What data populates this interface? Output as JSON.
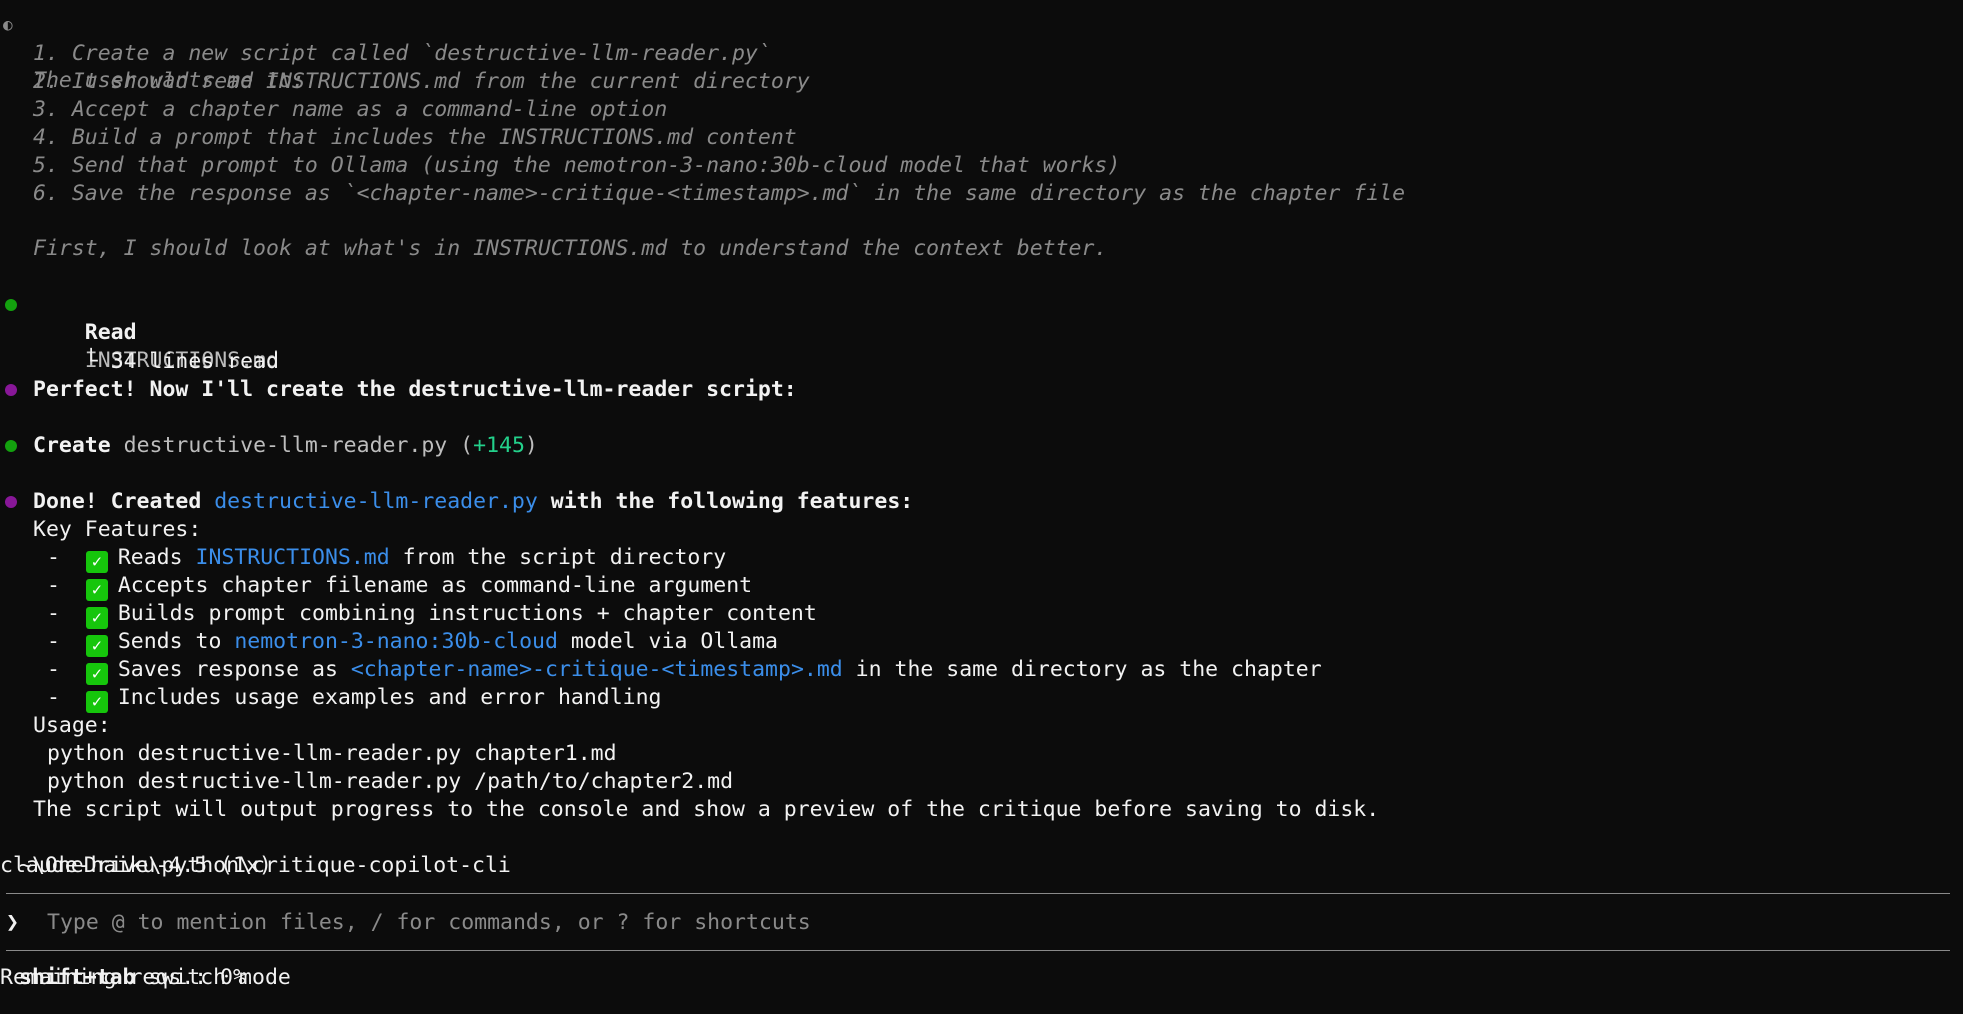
{
  "thinking": {
    "icon": "half-circle-icon",
    "lines": [
      "The user wants me to:",
      "1. Create a new script called `destructive-llm-reader.py`",
      "2. It should read INSTRUCTIONS.md from the current directory",
      "3. Accept a chapter name as a command-line option",
      "4. Build a prompt that includes the INSTRUCTIONS.md content",
      "5. Send that prompt to Ollama (using the nemotron-3-nano:30b-cloud model that works)",
      "6. Save the response as `<chapter-name>-critique-<timestamp>.md` in the same directory as the chapter file",
      "First, I should look at what's in INSTRUCTIONS.md to understand the context better."
    ]
  },
  "read_step": {
    "action": "Read",
    "target": "INSTRUCTIONS.md",
    "result_prefix": "└ ",
    "result": "34 lines read"
  },
  "message1": "Perfect! Now I'll create the destructive-llm-reader script:",
  "create_step": {
    "action": "Create",
    "target": "destructive-llm-reader.py",
    "open_paren": " (",
    "added": "+145",
    "close_paren": ")"
  },
  "done": {
    "prefix": "Done! Created ",
    "link": "destructive-llm-reader.py",
    "suffix": " with the following features:",
    "key_features_label": "Key Features:",
    "bullet": "-",
    "features": [
      {
        "before": "Reads ",
        "highlight": "INSTRUCTIONS.md",
        "after": " from the script directory"
      },
      {
        "before": "Accepts chapter filename as command-line argument",
        "highlight": "",
        "after": ""
      },
      {
        "before": "Builds prompt combining instructions + chapter content",
        "highlight": "",
        "after": ""
      },
      {
        "before": "Sends to ",
        "highlight": "nemotron-3-nano:30b-cloud",
        "after": " model via Ollama"
      },
      {
        "before": "Saves response as ",
        "highlight": "<chapter-name>-critique-<timestamp>.md",
        "after": " in the same directory as the chapter"
      },
      {
        "before": "Includes usage examples and error handling",
        "highlight": "",
        "after": ""
      }
    ],
    "usage_label": "Usage:",
    "usage_lines": [
      "python destructive-llm-reader.py chapter1.md",
      "python destructive-llm-reader.py /path/to/chapter2.md"
    ],
    "closing": "The script will output progress to the console and show a preview of the critique before saving to disk."
  },
  "status": {
    "path": "~\\OneDrive\\python\\critique-copilot-cli",
    "model": "claude-haiku-4.5 (1x)"
  },
  "input": {
    "prompt_glyph": "❯",
    "placeholder": "Type @ to mention files, / for commands, or ? for shortcuts"
  },
  "footer": {
    "key": "shift+tab",
    "key_desc": " switch mode",
    "remaining": "Remaining reqs.: 0%"
  },
  "colors": {
    "background": "#0c0c0c",
    "green_dot": "#13a10e",
    "purple_dot": "#881798",
    "link_blue": "#3b8eea",
    "check_green": "#16c60c"
  }
}
